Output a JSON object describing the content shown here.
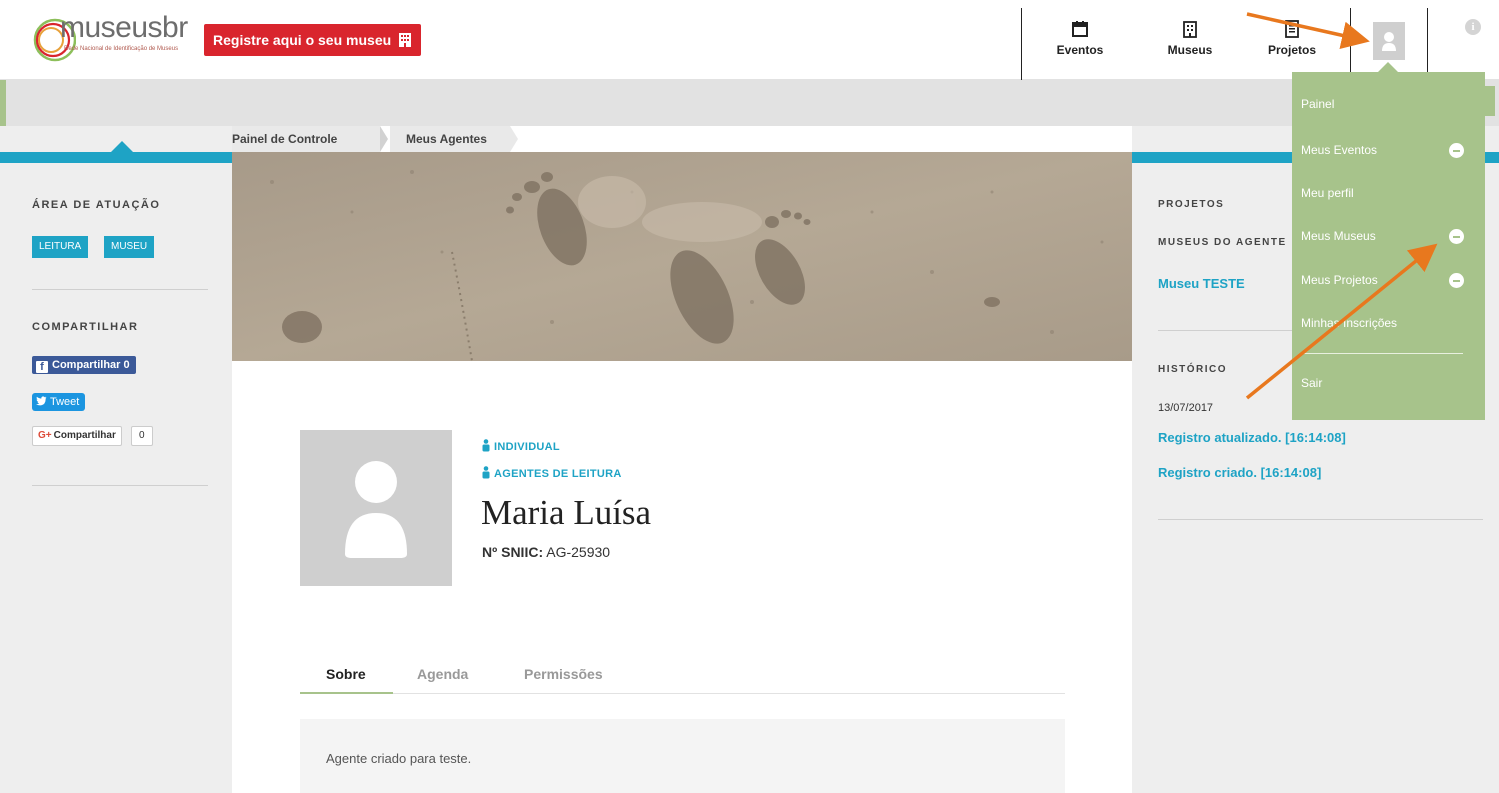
{
  "header": {
    "logo_text": "museusbr",
    "logo_subtitle": "Rede Nacional de Identificação de Museus",
    "register_label": "Registre aqui o seu museu",
    "nav": [
      {
        "label": "Eventos",
        "icon": "calendar-icon"
      },
      {
        "label": "Museus",
        "icon": "building-icon"
      },
      {
        "label": "Projetos",
        "icon": "document-icon"
      }
    ],
    "info_glyph": "i"
  },
  "breadcrumb": [
    "Painel de Controle",
    "Meus Agentes"
  ],
  "left": {
    "area_title": "ÁREA DE ATUAÇÃO",
    "tags": [
      "LEITURA",
      "MUSEU"
    ],
    "share_title": "COMPARTILHAR",
    "fb_label": "Compartilhar",
    "fb_count": "0",
    "tweet_label": "Tweet",
    "gplus_label": "Compartilhar",
    "gplus_count": "0"
  },
  "profile": {
    "type": "INDIVIDUAL",
    "area": "AGENTES DE LEITURA",
    "name": "Maria Luísa",
    "sniic_label": "Nº SNIIC:",
    "sniic_value": "AG-25930"
  },
  "tabs": [
    "Sobre",
    "Agenda",
    "Permissões"
  ],
  "about_text": "Agente criado para teste.",
  "right": {
    "projects_title": "PROJETOS",
    "museums_title": "MUSEUS DO AGENTE",
    "museum_link": "Museu TESTE",
    "history_title": "HISTÓRICO",
    "history_date": "13/07/2017",
    "history_items": [
      "Registro atualizado. [16:14:08]",
      "Registro criado. [16:14:08]"
    ]
  },
  "dropdown": {
    "items": [
      "Painel",
      "Meus Eventos",
      "Meu perfil",
      "Meus Museus",
      "Meus Projetos",
      "Minhas Inscrições",
      "Sair"
    ]
  },
  "colors": {
    "accent_blue": "#1ea3c5",
    "menu_green": "#a7c38b",
    "register_red": "#d9252d",
    "annotation_orange": "#e8781e"
  }
}
